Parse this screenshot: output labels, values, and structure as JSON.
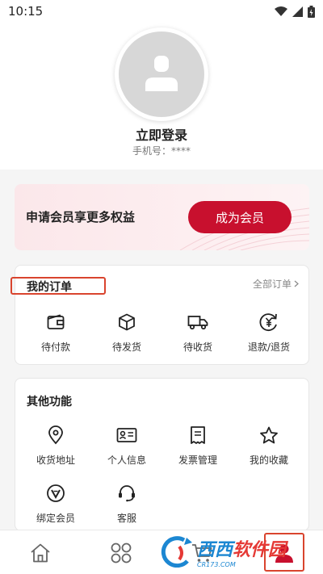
{
  "status_bar": {
    "time": "10:15",
    "icons": [
      "wifi-icon",
      "signal-icon",
      "battery-icon"
    ]
  },
  "profile": {
    "login_title": "立即登录",
    "phone_label": "手机号：",
    "phone_value": "****"
  },
  "member_banner": {
    "text": "申请会员享更多权益",
    "button_label": "成为会员"
  },
  "orders": {
    "title": "我的订单",
    "all_label": "全部订单",
    "items": [
      {
        "label": "待付款",
        "icon": "wallet-icon"
      },
      {
        "label": "待发货",
        "icon": "package-icon"
      },
      {
        "label": "待收货",
        "icon": "truck-icon"
      },
      {
        "label": "退款/退货",
        "icon": "refund-icon"
      }
    ]
  },
  "other": {
    "title": "其他功能",
    "items": [
      {
        "label": "收货地址",
        "icon": "location-pin-icon"
      },
      {
        "label": "个人信息",
        "icon": "id-card-icon"
      },
      {
        "label": "发票管理",
        "icon": "invoice-icon"
      },
      {
        "label": "我的收藏",
        "icon": "star-icon"
      },
      {
        "label": "绑定会员",
        "icon": "vip-badge-icon"
      },
      {
        "label": "客服",
        "icon": "headset-icon"
      }
    ]
  },
  "bottom_nav": {
    "items": [
      "home-icon",
      "categories-icon",
      "cart-icon",
      "profile-icon"
    ]
  },
  "colors": {
    "accent": "#c8102e",
    "highlight": "#d9442e"
  },
  "watermark": {
    "text_a": "西西",
    "text_b": "软件园",
    "sub": "CR173.COM"
  }
}
